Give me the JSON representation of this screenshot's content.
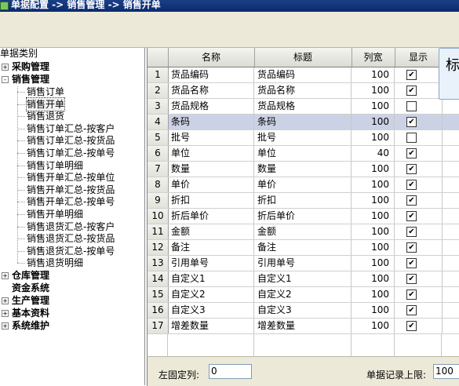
{
  "window": {
    "title": "单据配置 -> 销售管理 -> 销售开单"
  },
  "tree": {
    "root_label": "单据类别",
    "groups": [
      {
        "label": "采购管理",
        "expander": "+"
      },
      {
        "label": "销售管理",
        "expander": "-"
      },
      {
        "label": "仓库管理",
        "expander": "+"
      },
      {
        "label": "资金系统",
        "expander": ""
      },
      {
        "label": "生产管理",
        "expander": "+"
      },
      {
        "label": "基本资料",
        "expander": "+"
      },
      {
        "label": "系统维护",
        "expander": "+"
      }
    ],
    "sales_children": [
      "销售订单",
      "销售开单",
      "销售退货",
      "销售订单汇总-按客户",
      "销售订单汇总-按货品",
      "销售订单汇总-按单号",
      "销售订单明细",
      "销售开单汇总-按单位",
      "销售开单汇总-按货品",
      "销售开单汇总-按单号",
      "销售开单明细",
      "销售退货汇总-按客户",
      "销售退货汇总-按货品",
      "销售退货汇总-按单号",
      "销售退货明细"
    ],
    "selected_child": "销售开单"
  },
  "grid": {
    "columns": [
      "名称",
      "标题",
      "列宽",
      "显示"
    ],
    "rows": [
      {
        "n": "1",
        "name": "货品编码",
        "title": "货品编码",
        "width": "100",
        "show": true
      },
      {
        "n": "2",
        "name": "货品名称",
        "title": "货品名称",
        "width": "100",
        "show": true
      },
      {
        "n": "3",
        "name": "货品规格",
        "title": "货品规格",
        "width": "100",
        "show": false
      },
      {
        "n": "4",
        "name": "条码",
        "title": "条码",
        "width": "100",
        "show": true
      },
      {
        "n": "5",
        "name": "批号",
        "title": "批号",
        "width": "100",
        "show": false
      },
      {
        "n": "6",
        "name": "单位",
        "title": "单位",
        "width": "40",
        "show": true
      },
      {
        "n": "7",
        "name": "数量",
        "title": "数量",
        "width": "100",
        "show": true
      },
      {
        "n": "8",
        "name": "单价",
        "title": "单价",
        "width": "100",
        "show": true
      },
      {
        "n": "9",
        "name": "折扣",
        "title": "折扣",
        "width": "100",
        "show": true
      },
      {
        "n": "10",
        "name": "折后单价",
        "title": "折后单价",
        "width": "100",
        "show": true
      },
      {
        "n": "11",
        "name": "金额",
        "title": "金额",
        "width": "100",
        "show": true
      },
      {
        "n": "12",
        "name": "备注",
        "title": "备注",
        "width": "100",
        "show": true
      },
      {
        "n": "13",
        "name": "引用单号",
        "title": "引用单号",
        "width": "100",
        "show": true
      },
      {
        "n": "14",
        "name": "自定义1",
        "title": "自定义1",
        "width": "100",
        "show": true
      },
      {
        "n": "15",
        "name": "自定义2",
        "title": "自定义2",
        "width": "100",
        "show": true
      },
      {
        "n": "16",
        "name": "自定义3",
        "title": "自定义3",
        "width": "100",
        "show": true
      },
      {
        "n": "17",
        "name": "增差数量",
        "title": "增差数量",
        "width": "100",
        "show": true
      }
    ],
    "current_row": "4"
  },
  "tooltip": {
    "text": "标"
  },
  "bottom": {
    "left_fixed_label": "左固定列:",
    "left_fixed_value": "0",
    "record_limit_label": "单据记录上限:",
    "record_limit_value": "100"
  }
}
